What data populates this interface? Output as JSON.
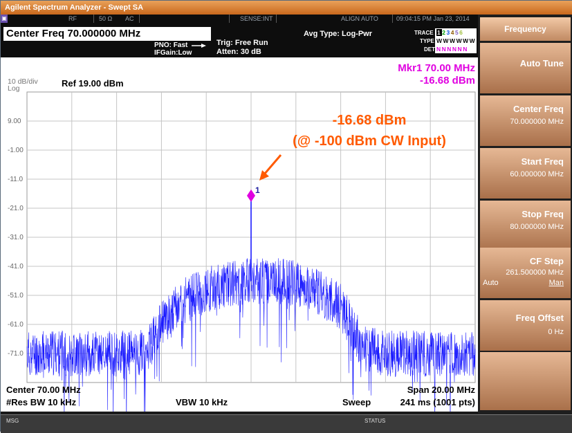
{
  "window": {
    "title": "Agilent Spectrum Analyzer - Swept SA"
  },
  "status_bar": {
    "rf_icon": "rf-connector-icon",
    "rf": "RF",
    "impedance": "50 Ω",
    "coupling": "AC",
    "sense": "SENSE:INT",
    "align": "ALIGN AUTO",
    "datetime": "09:04:15 PM Jan 23, 2014"
  },
  "header": {
    "center_freq": "Center Freq 70.000000 MHz",
    "pno": "PNO: Fast",
    "ifgain": "IFGain:Low",
    "trig": "Trig: Free Run",
    "atten": "Atten: 30 dB",
    "avg_type": "Avg Type: Log-Pwr",
    "trace_label": "TRACE",
    "type_label": "TYPE",
    "det_label": "DET",
    "trace_nums": [
      "1",
      "2",
      "3",
      "4",
      "5",
      "6"
    ],
    "type_values": "WWWWWW",
    "det_values": "NNNNNN",
    "trace_colors": [
      "#000000",
      "#00a000",
      "#0050e0",
      "#8b5a00",
      "#8060c0",
      "#a0c040"
    ]
  },
  "plot": {
    "scale": "10 dB/div",
    "scale_type": "Log",
    "ref": "Ref 19.00 dBm",
    "marker_readout_freq": "Mkr1 70.00 MHz",
    "marker_readout_amp": "-16.68 dBm",
    "marker_num": "1",
    "annotation_line1": "-16.68 dBm",
    "annotation_line2": "(@ -100 dBm CW Input)",
    "center": "Center 70.00 MHz",
    "span": "Span 20.00 MHz",
    "res_bw": "#Res BW 10 kHz",
    "vbw": "VBW 10 kHz",
    "sweep_label": "Sweep",
    "sweep_value": "241 ms (1001 pts)",
    "colors": {
      "trace": "#1a1aff",
      "marker": "#e000e0",
      "annotation": "#ff5a00"
    }
  },
  "chart_data": {
    "type": "line",
    "title": "",
    "xlabel": "",
    "ylabel": "",
    "x_unit": "MHz",
    "xlim": [
      60,
      80
    ],
    "ylim": [
      -81,
      19
    ],
    "y_tick_labels": [
      "9.00",
      "-1.00",
      "-11.0",
      "-21.0",
      "-31.0",
      "-41.0",
      "-51.0",
      "-61.0",
      "-71.0"
    ],
    "y_ticks": [
      9,
      -1,
      -11,
      -21,
      -31,
      -41,
      -51,
      -61,
      -71
    ],
    "grid": true,
    "noise_envelope": {
      "x": [
        60,
        62,
        64,
        65,
        65.5,
        66,
        67,
        68,
        69,
        70,
        71,
        72,
        73,
        74,
        74.5,
        75,
        76,
        78,
        80
      ],
      "y": [
        -71,
        -71,
        -71,
        -71,
        -68,
        -61,
        -53,
        -49,
        -47,
        -46,
        -46,
        -47,
        -50,
        -55,
        -62,
        -69,
        -71,
        -71,
        -71
      ]
    },
    "noise_spread_db": 8,
    "marker": {
      "x": 70.0,
      "y": -16.68
    }
  },
  "menu": {
    "title": "Frequency",
    "keys": [
      {
        "label": "Auto Tune",
        "value": ""
      },
      {
        "label": "Center Freq",
        "value": "70.000000 MHz"
      },
      {
        "label": "Start Freq",
        "value": "60.000000 MHz"
      },
      {
        "label": "Stop Freq",
        "value": "80.000000 MHz"
      },
      {
        "label": "CF Step",
        "value": "261.500000 MHz",
        "opt_auto": "Auto",
        "opt_man": "Man"
      },
      {
        "label": "Freq Offset",
        "value": "0 Hz"
      }
    ]
  },
  "bottom": {
    "msg": "MSG",
    "status": "STATUS"
  }
}
